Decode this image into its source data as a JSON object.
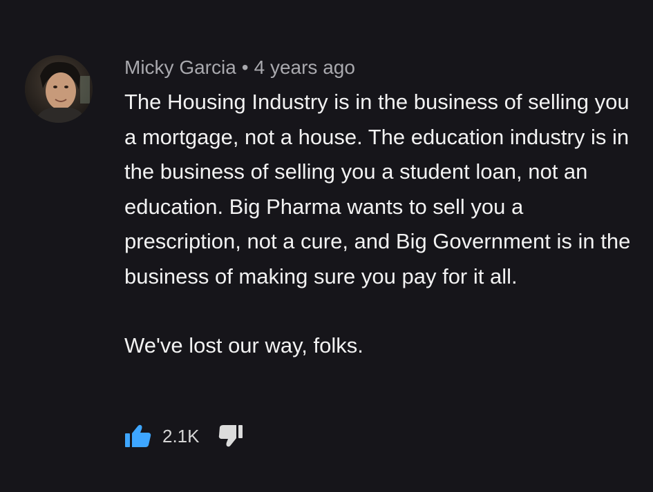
{
  "comment": {
    "author": "Micky Garcia",
    "separator": "•",
    "timestamp": "4 years ago",
    "paragraphs": [
      "The Housing Industry is in the business of selling you a mortgage, not a house.  The education industry is in the business of selling you a student loan, not an education.  Big Pharma wants to sell you a prescription, not a cure, and Big Government is in the business of making sure you pay for it all.",
      "We've lost our way, folks."
    ],
    "likes": "2.1K"
  },
  "icons": {
    "avatar": "user-avatar",
    "like": "thumbs-up-icon",
    "dislike": "thumbs-down-icon"
  },
  "colors": {
    "background": "#16151a",
    "text": "#f2f2f2",
    "meta": "#a9a9ae",
    "like_active": "#3ea6ff",
    "dislike": "#dcdcdc"
  }
}
